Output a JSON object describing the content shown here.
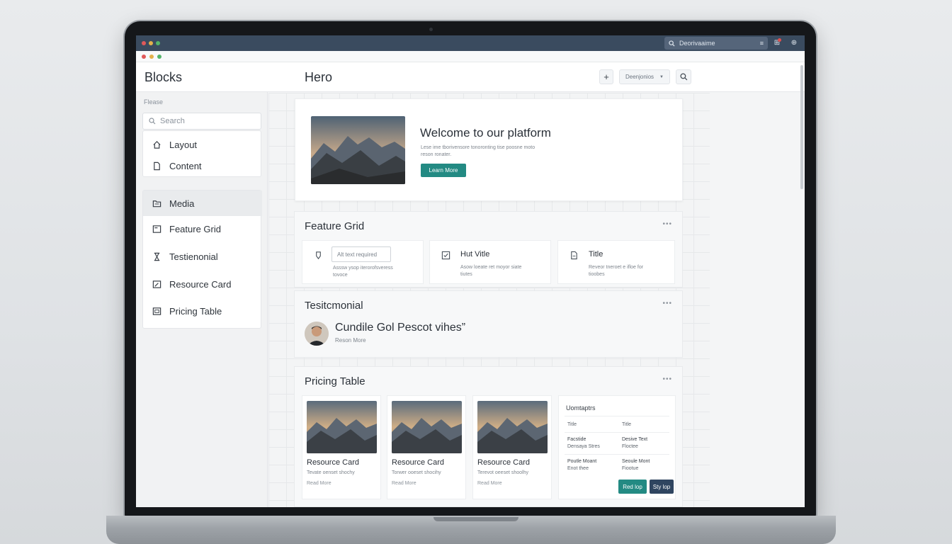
{
  "os": {
    "search_text": "Deorivaaime"
  },
  "header": {
    "blocks_title": "Blocks",
    "hero_title": "Hero",
    "add_label": "+",
    "dropdown_label": "Deenjonios"
  },
  "sidebar": {
    "caption": "Flease",
    "search_placeholder": "Search",
    "group1": [
      {
        "label": "Layout",
        "icon": "home-icon"
      },
      {
        "label": "Content",
        "icon": "document-icon"
      }
    ],
    "group2": [
      {
        "label": "Media",
        "icon": "folder-icon",
        "active": true
      },
      {
        "label": "Feature Grid",
        "icon": "layout-icon"
      },
      {
        "label": "Testienonial",
        "icon": "hourglass-icon"
      },
      {
        "label": "Resource Card",
        "icon": "edit-square-icon"
      },
      {
        "label": "Pricing Table",
        "icon": "image-square-icon"
      }
    ]
  },
  "hero": {
    "heading": "Welcome to our platform",
    "body_line1": "Lese ime tborivensore tonoronting tise poosne moto",
    "body_line2": "reson ronater.",
    "cta": "Learn More"
  },
  "feature_grid": {
    "title": "Feature Grid",
    "more": "•••",
    "items": [
      {
        "input_placeholder": "Alt text required",
        "desc1": "Asssw ysop iterorofsveress",
        "desc2": "tovoce"
      },
      {
        "title": "Hut Vitle",
        "desc1": "Asow loeate ret moyor siate",
        "desc2": "tiutes"
      },
      {
        "title": "Title",
        "desc1": "Reveor tneroet e ifloe for",
        "desc2": "tioobes"
      }
    ]
  },
  "testimonial": {
    "title": "Tesitcmonial",
    "more": "•••",
    "quote": "Cundile Gol Pescot vihes”",
    "link": "Reson More"
  },
  "pricing": {
    "title": "Pricing Table",
    "more": "•••",
    "cards": [
      {
        "title": "Resource Card",
        "desc": "Tevate oenset shochy",
        "link": "Read More"
      },
      {
        "title": "Resource Card",
        "desc": "Torwer ooeset shocihy",
        "link": "Read More"
      },
      {
        "title": "Resource Card",
        "desc": "Terevot oeeset shoolhy",
        "link": "Read More"
      }
    ],
    "table": {
      "title": "Uomtaptrs",
      "col1": "Title",
      "col2": "Title",
      "rows": [
        {
          "a1": "Facstide",
          "a2": "Densaya Stres",
          "b1": "Desive Text",
          "b2": "Floctee"
        },
        {
          "a1": "Poutle Moant",
          "a2": "Enot thee",
          "b1": "Seoule Mont",
          "b2": "Fiootue"
        }
      ],
      "btn_primary": "Red lop",
      "btn_secondary": "Sty lop"
    }
  }
}
